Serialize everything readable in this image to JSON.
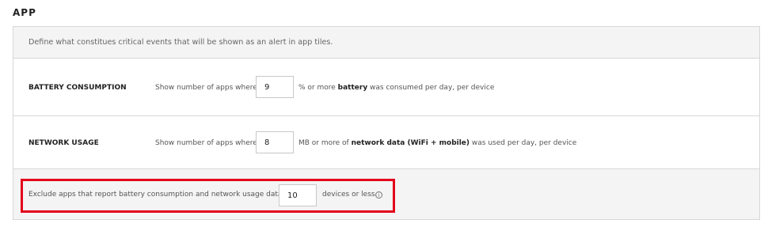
{
  "section": {
    "title": "APP"
  },
  "description": "Define what constitues critical events that will be shown as an alert in app tiles.",
  "battery": {
    "label": "BATTERY CONSUMPTION",
    "prefix": "Show number of apps where",
    "value": "9",
    "suffix_pre": "% or more ",
    "suffix_bold": "battery",
    "suffix_post": " was consumed per day, per device"
  },
  "network": {
    "label": "NETWORK USAGE",
    "prefix": "Show number of apps where",
    "value": "8",
    "suffix_pre": "MB or more of ",
    "suffix_bold": "network data (WiFi + mobile)",
    "suffix_post": " was used per day, per device"
  },
  "exclude": {
    "prefix": "Exclude apps that report battery consumption and network usage data for",
    "value": "10",
    "suffix": "devices or less.",
    "info_icon": "info-icon",
    "info_glyph": "i"
  },
  "colors": {
    "highlight": "#e3001b",
    "row_gray": "#f4f4f4",
    "border": "#d7d7d7"
  }
}
